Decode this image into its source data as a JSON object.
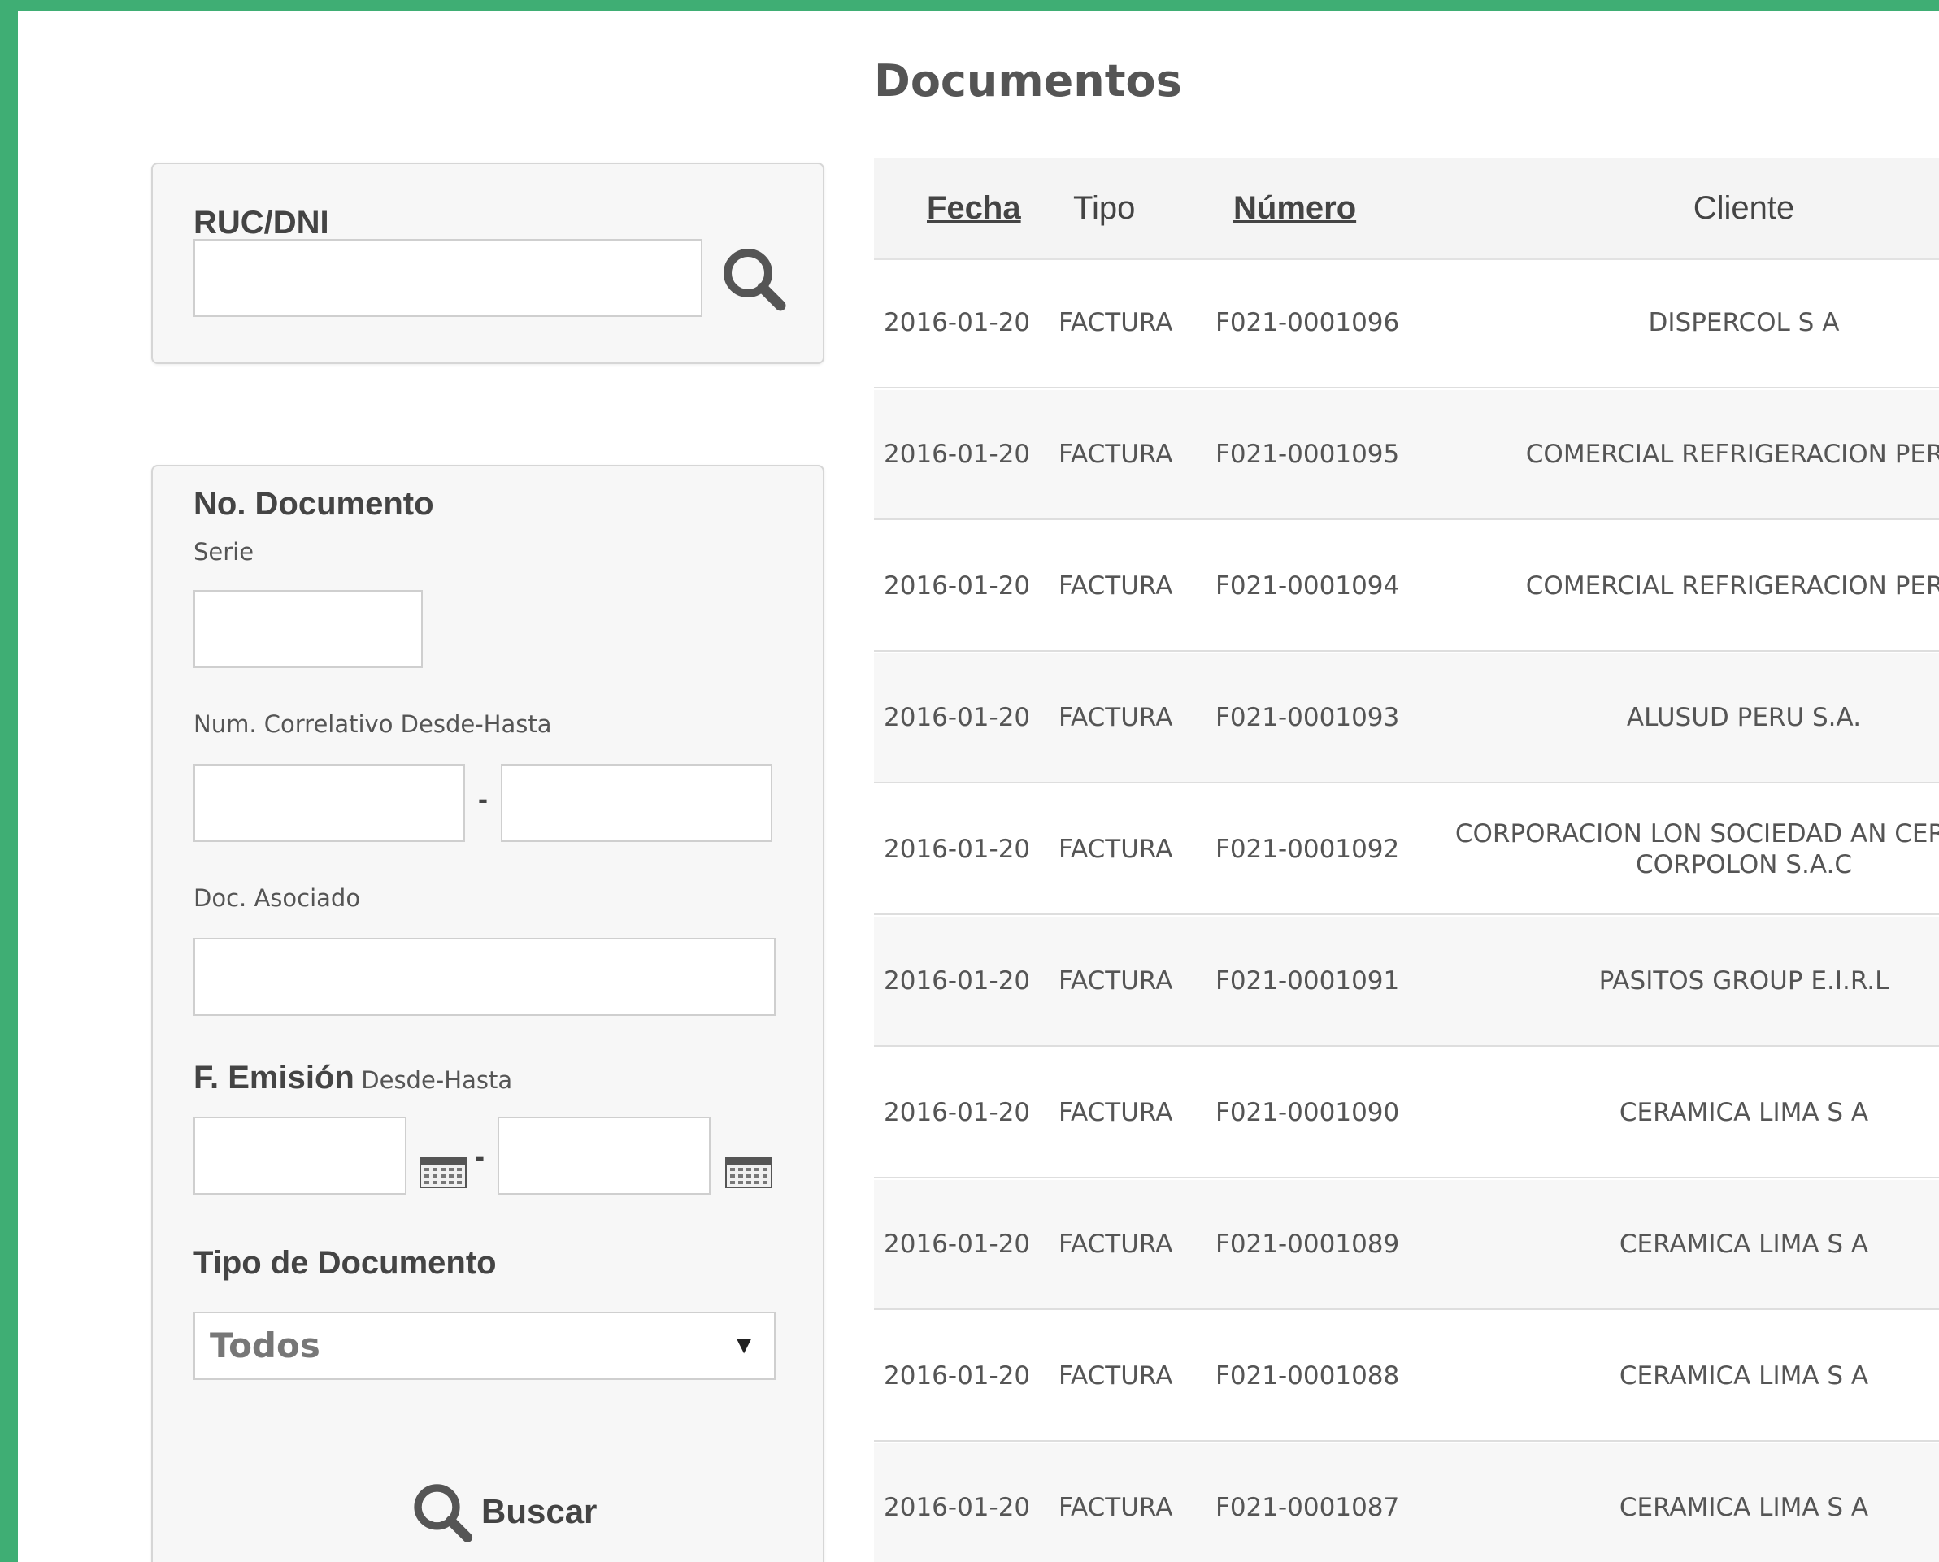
{
  "page": {
    "title": "Documentos"
  },
  "ruc_panel": {
    "label": "RUC/DNI",
    "input_value": ""
  },
  "doc_panel": {
    "title": "No. Documento",
    "serie_label": "Serie",
    "serie_value": "",
    "correlativo_label": "Num. Correlativo Desde-Hasta",
    "correlativo_from": "",
    "correlativo_sep": "-",
    "correlativo_to": "",
    "asociado_label": "Doc. Asociado",
    "asociado_value": "",
    "emision_label": "F. Emisión",
    "emision_sublabel": "Desde-Hasta",
    "emision_from": "",
    "emision_sep": "-",
    "emision_to": "",
    "tipo_label": "Tipo de Documento",
    "tipo_selected": "Todos",
    "buscar_label": "Buscar"
  },
  "table": {
    "headers": {
      "fecha": "Fecha",
      "tipo": "Tipo",
      "numero": "Número",
      "cliente": "Cliente"
    },
    "rows": [
      {
        "fecha": "2016-01-20",
        "tipo": "FACTURA",
        "numero": "F021-0001096",
        "cliente": "DISPERCOL S A"
      },
      {
        "fecha": "2016-01-20",
        "tipo": "FACTURA",
        "numero": "F021-0001095",
        "cliente": "COMERCIAL REFRIGERACION PERU"
      },
      {
        "fecha": "2016-01-20",
        "tipo": "FACTURA",
        "numero": "F021-0001094",
        "cliente": "COMERCIAL REFRIGERACION PERU"
      },
      {
        "fecha": "2016-01-20",
        "tipo": "FACTURA",
        "numero": "F021-0001093",
        "cliente": "ALUSUD PERU S.A."
      },
      {
        "fecha": "2016-01-20",
        "tipo": "FACTURA",
        "numero": "F021-0001092",
        "cliente": "CORPORACION LON SOCIEDAD AN CERRADA - CORPOLON S.A.C"
      },
      {
        "fecha": "2016-01-20",
        "tipo": "FACTURA",
        "numero": "F021-0001091",
        "cliente": "PASITOS GROUP E.I.R.L"
      },
      {
        "fecha": "2016-01-20",
        "tipo": "FACTURA",
        "numero": "F021-0001090",
        "cliente": "CERAMICA LIMA S A"
      },
      {
        "fecha": "2016-01-20",
        "tipo": "FACTURA",
        "numero": "F021-0001089",
        "cliente": "CERAMICA LIMA S A"
      },
      {
        "fecha": "2016-01-20",
        "tipo": "FACTURA",
        "numero": "F021-0001088",
        "cliente": "CERAMICA LIMA S A"
      },
      {
        "fecha": "2016-01-20",
        "tipo": "FACTURA",
        "numero": "F021-0001087",
        "cliente": "CERAMICA LIMA S A"
      }
    ]
  },
  "colors": {
    "frame_border": "#3fae74",
    "frame_outer": "#37474c",
    "panel_bg": "#f7f7f7",
    "text": "#555555"
  },
  "icons": [
    "search-icon",
    "calendar-icon",
    "dropdown-arrow-icon"
  ]
}
